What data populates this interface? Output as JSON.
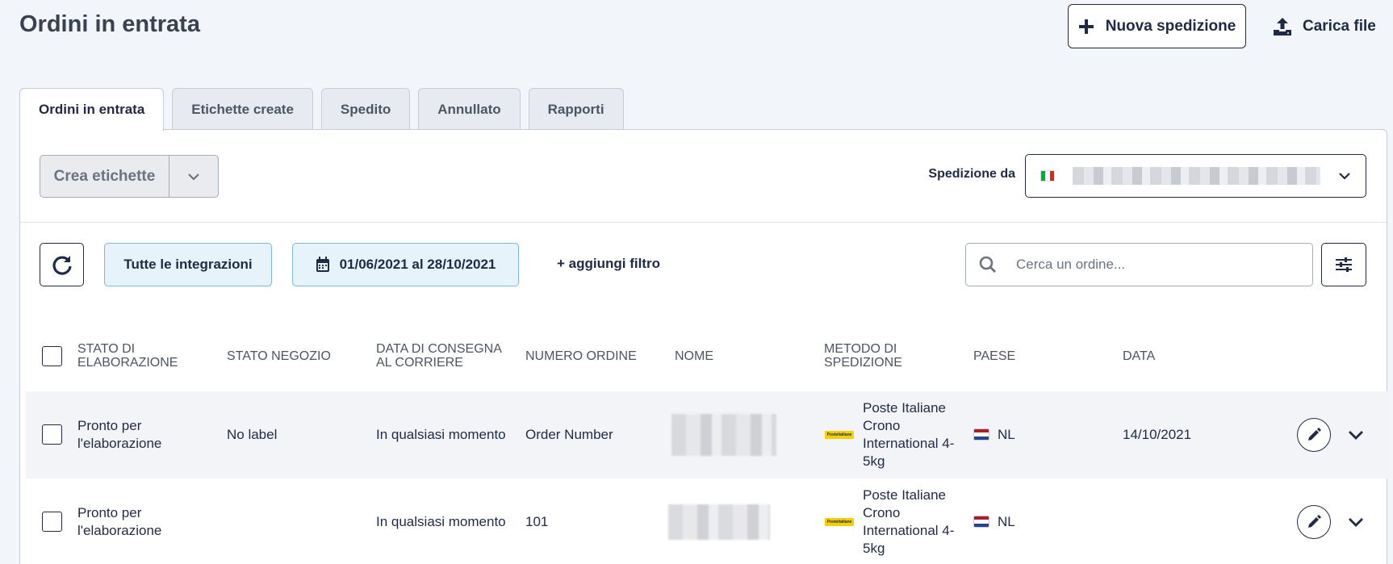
{
  "page": {
    "title": "Ordini in entrata"
  },
  "header_actions": {
    "new_shipment": "Nuova spedizione",
    "upload_file": "Carica file"
  },
  "tabs": [
    {
      "label": "Ordini in entrata",
      "active": true
    },
    {
      "label": "Etichette create"
    },
    {
      "label": "Spedito"
    },
    {
      "label": "Annullato"
    },
    {
      "label": "Rapporti"
    }
  ],
  "toolbar": {
    "create_labels": "Crea etichette",
    "ship_from_label": "Spedizione da",
    "ship_from_flag": "IT",
    "integrations": "Tutte le integrazioni",
    "date_range": "01/06/2021 al 28/10/2021",
    "add_filter": "+ aggiungi filtro",
    "search_placeholder": "Cerca un ordine..."
  },
  "table": {
    "headers": {
      "processing_status": "STATO DI ELABORAZIONE",
      "store_status": "STATO NEGOZIO",
      "delivery_date": "DATA DI CONSEGNA AL CORRIERE",
      "order_number": "NUMERO ORDINE",
      "name": "NOME",
      "shipping_method": "METODO DI SPEDIZIONE",
      "country": "PAESE",
      "date": "DATA"
    },
    "rows": [
      {
        "processing_status": "Pronto per l'elaborazione",
        "store_status": "No label",
        "delivery_date": "In qualsiasi momento",
        "order_number": "Order Number",
        "shipping_method": "Poste Italiane Crono International 4-5kg",
        "carrier_logo": "Posteitaliane",
        "country": "NL",
        "date": "14/10/2021"
      },
      {
        "processing_status": "Pronto per l'elaborazione",
        "store_status": "",
        "delivery_date": "In qualsiasi momento",
        "order_number": "101",
        "shipping_method": "Poste Italiane Crono International 4-5kg",
        "carrier_logo": "Posteitaliane",
        "country": "NL",
        "date": ""
      }
    ]
  },
  "colors": {
    "primary": "#1f2a44",
    "accent_bg": "#e6f3fb",
    "accent_border": "#7fb6dd",
    "poste_yellow": "#f5d000"
  },
  "icons": [
    "plus-icon",
    "upload-icon",
    "chevron-down-icon",
    "italy-flag-icon",
    "refresh-icon",
    "calendar-icon",
    "search-icon",
    "sliders-icon",
    "poste-italiane-logo",
    "netherlands-flag-icon",
    "pencil-icon"
  ]
}
